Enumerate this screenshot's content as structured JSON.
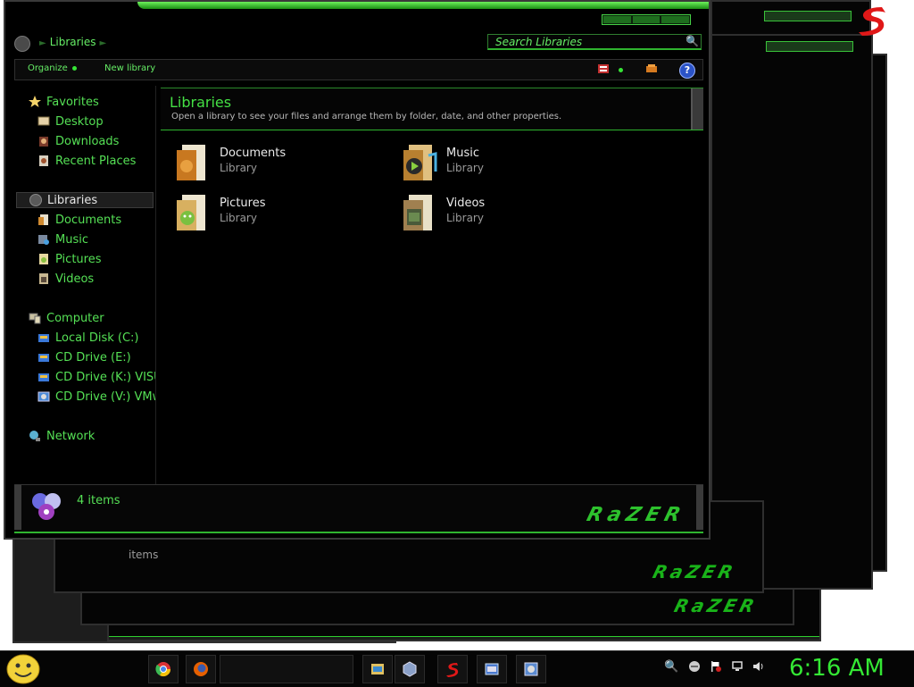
{
  "window": {
    "breadcrumb": [
      "Libraries"
    ],
    "search_placeholder": "Search Libraries",
    "toolbar": {
      "organize": "Organize",
      "new_library": "New library",
      "help": "?"
    }
  },
  "nav": {
    "favorites": {
      "label": "Favorites",
      "items": [
        "Desktop",
        "Downloads",
        "Recent Places"
      ]
    },
    "libraries": {
      "label": "Libraries",
      "items": [
        "Documents",
        "Music",
        "Pictures",
        "Videos"
      ]
    },
    "computer": {
      "label": "Computer",
      "items": [
        "Local Disk (C:)",
        "CD Drive (E:)",
        "CD Drive (K:) VISU",
        "CD Drive (V:) VMw"
      ]
    },
    "network": {
      "label": "Network"
    }
  },
  "header": {
    "title": "Libraries",
    "subtitle": "Open a library to see your files and arrange them by folder, date, and other properties."
  },
  "libraries": [
    {
      "name": "Documents",
      "type": "Library"
    },
    {
      "name": "Music",
      "type": "Library"
    },
    {
      "name": "Pictures",
      "type": "Library"
    },
    {
      "name": "Videos",
      "type": "Library"
    }
  ],
  "details": {
    "count": "4 items",
    "brand": "RaZER"
  },
  "background": {
    "brand": "RaZER",
    "items_text": "items"
  },
  "taskbar": {
    "time": "6:16 AM"
  },
  "colors": {
    "accent": "#33dd33",
    "background": "#000000",
    "frame": "#3a3a3a"
  }
}
